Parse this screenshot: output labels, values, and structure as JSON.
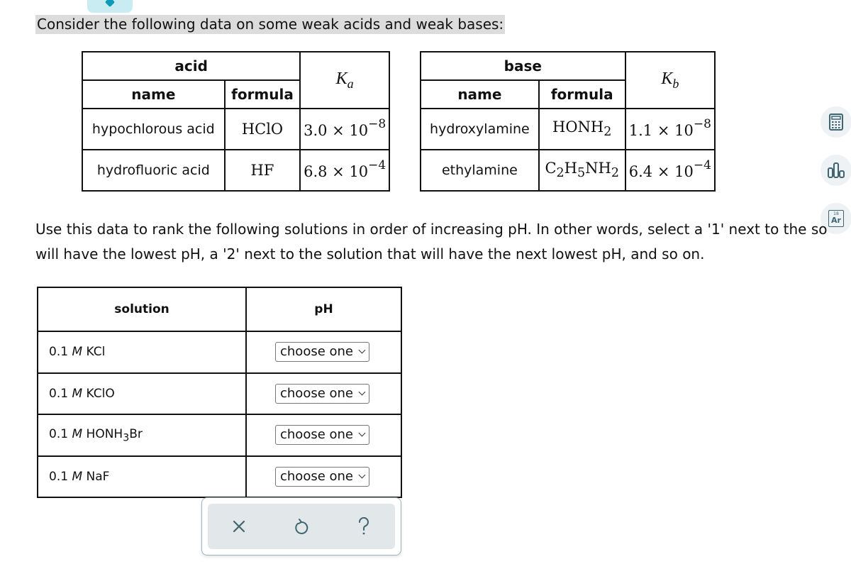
{
  "intro_text": "Consider the following data on some weak acids and weak bases:",
  "acid_table": {
    "group_header": "acid",
    "col_name": "name",
    "col_formula": "formula",
    "k_symbol": "K",
    "k_subscript": "a",
    "rows": [
      {
        "name": "hypochlorous acid",
        "formula": "HClO",
        "k_mantissa": "3.0",
        "k_exp": "−8"
      },
      {
        "name": "hydrofluoric acid",
        "formula": "HF",
        "k_mantissa": "6.8",
        "k_exp": "−4"
      }
    ]
  },
  "base_table": {
    "group_header": "base",
    "col_name": "name",
    "col_formula": "formula",
    "k_symbol": "K",
    "k_subscript": "b",
    "rows": [
      {
        "name": "hydroxylamine",
        "formula_html": [
          "HONH",
          "2"
        ],
        "k_mantissa": "1.1",
        "k_exp": "−8"
      },
      {
        "name": "ethylamine",
        "formula_parts": [
          "C",
          "2",
          "H",
          "5",
          "NH",
          "2"
        ],
        "k_mantissa": "6.4",
        "k_exp": "−4"
      }
    ]
  },
  "sci_times": "× 10",
  "instructions": {
    "line1": "Use this data to rank the following solutions in order of increasing pH. In other words, select a '1' next to the so",
    "line2": "will have the lowest pH, a '2' next to the solution that will have the next lowest pH, and so on."
  },
  "solution_table": {
    "col_solution": "solution",
    "col_ph": "pH",
    "conc": "0.1",
    "unit": "M",
    "rows": [
      {
        "solute": "KCl",
        "selected": "choose one"
      },
      {
        "solute": "KClO",
        "selected": "choose one"
      },
      {
        "solute_pre": "HONH",
        "solute_sub": "3",
        "solute_post": "Br",
        "selected": "choose one"
      },
      {
        "solute": "NaF",
        "selected": "choose one"
      }
    ]
  },
  "toolbar": {
    "clear_icon": "x-icon",
    "undo_icon": "undo-icon",
    "help_icon": "question-icon"
  },
  "side_tools": {
    "calculator": "calculator-icon",
    "chart": "bar-chart-icon",
    "periodic_table_number": "18",
    "periodic_table_symbol": "Ar"
  },
  "colors": {
    "accent": "#0b9bb8",
    "toolbar_bg": "#e2e7ea",
    "icon": "#3f6570"
  }
}
